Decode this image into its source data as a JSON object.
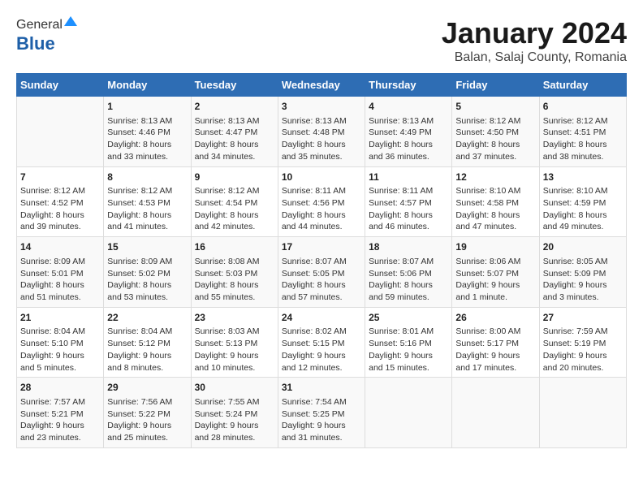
{
  "logo": {
    "general": "General",
    "blue": "Blue"
  },
  "title": "January 2024",
  "subtitle": "Balan, Salaj County, Romania",
  "days_of_week": [
    "Sunday",
    "Monday",
    "Tuesday",
    "Wednesday",
    "Thursday",
    "Friday",
    "Saturday"
  ],
  "weeks": [
    [
      {
        "day": "",
        "info": ""
      },
      {
        "day": "1",
        "info": "Sunrise: 8:13 AM\nSunset: 4:46 PM\nDaylight: 8 hours\nand 33 minutes."
      },
      {
        "day": "2",
        "info": "Sunrise: 8:13 AM\nSunset: 4:47 PM\nDaylight: 8 hours\nand 34 minutes."
      },
      {
        "day": "3",
        "info": "Sunrise: 8:13 AM\nSunset: 4:48 PM\nDaylight: 8 hours\nand 35 minutes."
      },
      {
        "day": "4",
        "info": "Sunrise: 8:13 AM\nSunset: 4:49 PM\nDaylight: 8 hours\nand 36 minutes."
      },
      {
        "day": "5",
        "info": "Sunrise: 8:12 AM\nSunset: 4:50 PM\nDaylight: 8 hours\nand 37 minutes."
      },
      {
        "day": "6",
        "info": "Sunrise: 8:12 AM\nSunset: 4:51 PM\nDaylight: 8 hours\nand 38 minutes."
      }
    ],
    [
      {
        "day": "7",
        "info": "Sunrise: 8:12 AM\nSunset: 4:52 PM\nDaylight: 8 hours\nand 39 minutes."
      },
      {
        "day": "8",
        "info": "Sunrise: 8:12 AM\nSunset: 4:53 PM\nDaylight: 8 hours\nand 41 minutes."
      },
      {
        "day": "9",
        "info": "Sunrise: 8:12 AM\nSunset: 4:54 PM\nDaylight: 8 hours\nand 42 minutes."
      },
      {
        "day": "10",
        "info": "Sunrise: 8:11 AM\nSunset: 4:56 PM\nDaylight: 8 hours\nand 44 minutes."
      },
      {
        "day": "11",
        "info": "Sunrise: 8:11 AM\nSunset: 4:57 PM\nDaylight: 8 hours\nand 46 minutes."
      },
      {
        "day": "12",
        "info": "Sunrise: 8:10 AM\nSunset: 4:58 PM\nDaylight: 8 hours\nand 47 minutes."
      },
      {
        "day": "13",
        "info": "Sunrise: 8:10 AM\nSunset: 4:59 PM\nDaylight: 8 hours\nand 49 minutes."
      }
    ],
    [
      {
        "day": "14",
        "info": "Sunrise: 8:09 AM\nSunset: 5:01 PM\nDaylight: 8 hours\nand 51 minutes."
      },
      {
        "day": "15",
        "info": "Sunrise: 8:09 AM\nSunset: 5:02 PM\nDaylight: 8 hours\nand 53 minutes."
      },
      {
        "day": "16",
        "info": "Sunrise: 8:08 AM\nSunset: 5:03 PM\nDaylight: 8 hours\nand 55 minutes."
      },
      {
        "day": "17",
        "info": "Sunrise: 8:07 AM\nSunset: 5:05 PM\nDaylight: 8 hours\nand 57 minutes."
      },
      {
        "day": "18",
        "info": "Sunrise: 8:07 AM\nSunset: 5:06 PM\nDaylight: 8 hours\nand 59 minutes."
      },
      {
        "day": "19",
        "info": "Sunrise: 8:06 AM\nSunset: 5:07 PM\nDaylight: 9 hours\nand 1 minute."
      },
      {
        "day": "20",
        "info": "Sunrise: 8:05 AM\nSunset: 5:09 PM\nDaylight: 9 hours\nand 3 minutes."
      }
    ],
    [
      {
        "day": "21",
        "info": "Sunrise: 8:04 AM\nSunset: 5:10 PM\nDaylight: 9 hours\nand 5 minutes."
      },
      {
        "day": "22",
        "info": "Sunrise: 8:04 AM\nSunset: 5:12 PM\nDaylight: 9 hours\nand 8 minutes."
      },
      {
        "day": "23",
        "info": "Sunrise: 8:03 AM\nSunset: 5:13 PM\nDaylight: 9 hours\nand 10 minutes."
      },
      {
        "day": "24",
        "info": "Sunrise: 8:02 AM\nSunset: 5:15 PM\nDaylight: 9 hours\nand 12 minutes."
      },
      {
        "day": "25",
        "info": "Sunrise: 8:01 AM\nSunset: 5:16 PM\nDaylight: 9 hours\nand 15 minutes."
      },
      {
        "day": "26",
        "info": "Sunrise: 8:00 AM\nSunset: 5:17 PM\nDaylight: 9 hours\nand 17 minutes."
      },
      {
        "day": "27",
        "info": "Sunrise: 7:59 AM\nSunset: 5:19 PM\nDaylight: 9 hours\nand 20 minutes."
      }
    ],
    [
      {
        "day": "28",
        "info": "Sunrise: 7:57 AM\nSunset: 5:21 PM\nDaylight: 9 hours\nand 23 minutes."
      },
      {
        "day": "29",
        "info": "Sunrise: 7:56 AM\nSunset: 5:22 PM\nDaylight: 9 hours\nand 25 minutes."
      },
      {
        "day": "30",
        "info": "Sunrise: 7:55 AM\nSunset: 5:24 PM\nDaylight: 9 hours\nand 28 minutes."
      },
      {
        "day": "31",
        "info": "Sunrise: 7:54 AM\nSunset: 5:25 PM\nDaylight: 9 hours\nand 31 minutes."
      },
      {
        "day": "",
        "info": ""
      },
      {
        "day": "",
        "info": ""
      },
      {
        "day": "",
        "info": ""
      }
    ]
  ]
}
